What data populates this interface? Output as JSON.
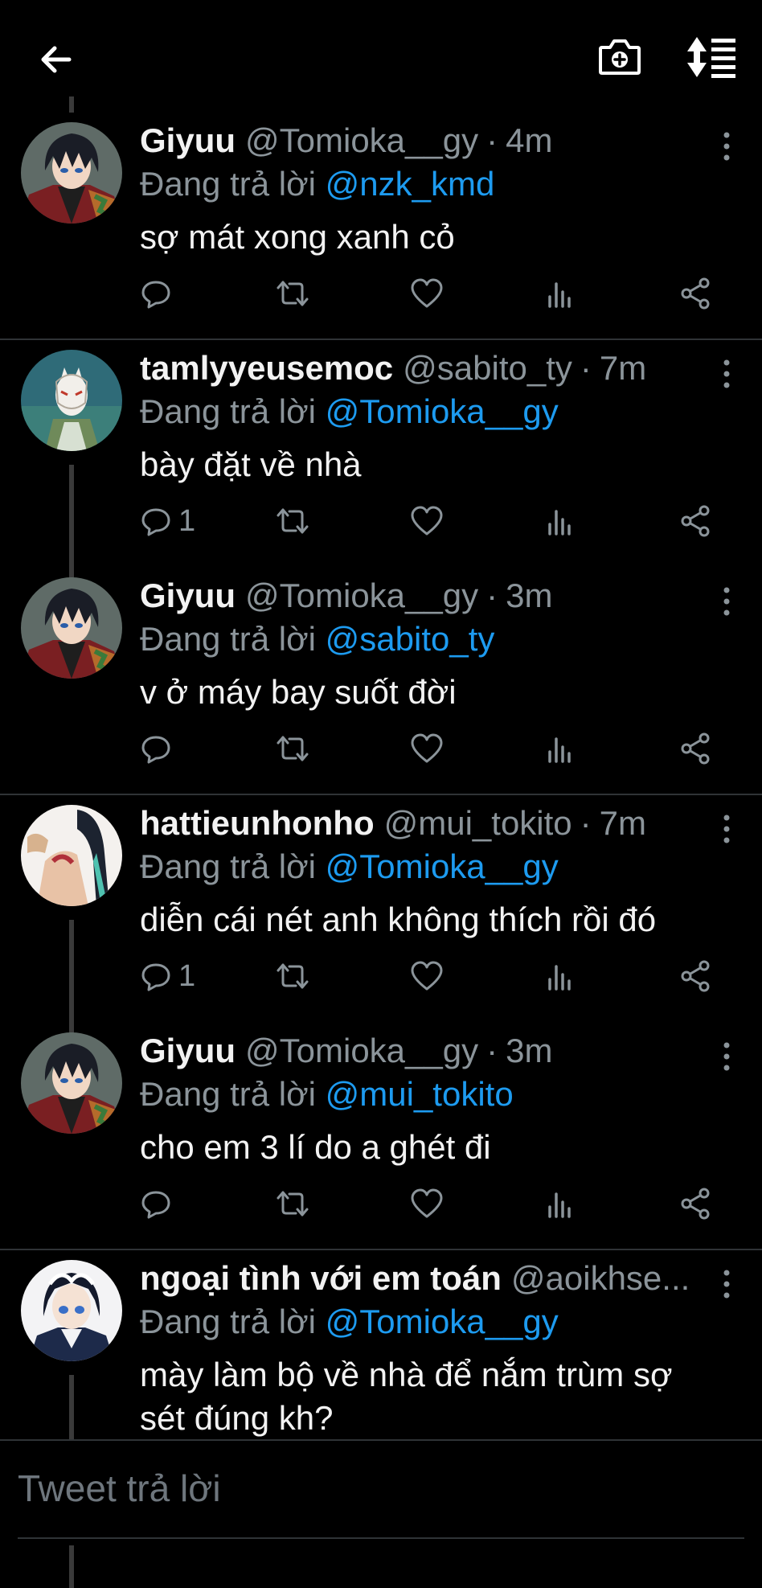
{
  "colors": {
    "background": "#000000",
    "primary_text": "#f2f2f2",
    "secondary_text": "#8b949a",
    "link": "#1d9bf0",
    "divider": "#2f3336"
  },
  "topbar": {
    "back_icon": "arrow-left-icon",
    "camera_icon": "camera-plus-icon",
    "sort_icon": "sort-list-icon"
  },
  "tweets": [
    {
      "name": "Giyuu",
      "handle": "@Tomioka__gy",
      "time": "4m",
      "reply_prefix": "Đang trả lời ",
      "reply_to": "@nzk_kmd",
      "text": "sợ mát xong xanh cỏ",
      "reply_count": "",
      "avatar": "giyuu-avatar"
    },
    {
      "name": "tamlyyeusemoc",
      "handle": "@sabito_ty",
      "time": "7m",
      "reply_prefix": "Đang trả lời ",
      "reply_to": "@Tomioka__gy",
      "text": "bày đặt về nhà",
      "reply_count": "1",
      "avatar": "sabito-avatar"
    },
    {
      "name": "Giyuu",
      "handle": "@Tomioka__gy",
      "time": "3m",
      "reply_prefix": "Đang trả lời ",
      "reply_to": "@sabito_ty",
      "text": "v ở máy bay suốt đời",
      "reply_count": "",
      "avatar": "giyuu-avatar"
    },
    {
      "name": "hattieunhonho",
      "handle": "@mui_tokito",
      "time": "7m",
      "reply_prefix": "Đang trả lời ",
      "reply_to": "@Tomioka__gy",
      "text": "diễn cái nét anh không thích rồi đó",
      "reply_count": "1",
      "avatar": "muichiro-avatar"
    },
    {
      "name": "Giyuu",
      "handle": "@Tomioka__gy",
      "time": "3m",
      "reply_prefix": "Đang trả lời ",
      "reply_to": "@mui_tokito",
      "text": "cho em 3 lí do a ghét đi",
      "reply_count": "",
      "avatar": "giyuu-avatar"
    },
    {
      "name": "ngoại tình với em toán",
      "handle": "@aoikhse...",
      "time": "",
      "reply_prefix": "Đang trả lời ",
      "reply_to": "@Tomioka__gy",
      "text": "mày làm bộ về nhà để nắm trùm sợ sét đúng kh?",
      "reply_count": "",
      "avatar": "aoi-avatar"
    }
  ],
  "reply_box": {
    "placeholder": "Tweet trả lời"
  }
}
